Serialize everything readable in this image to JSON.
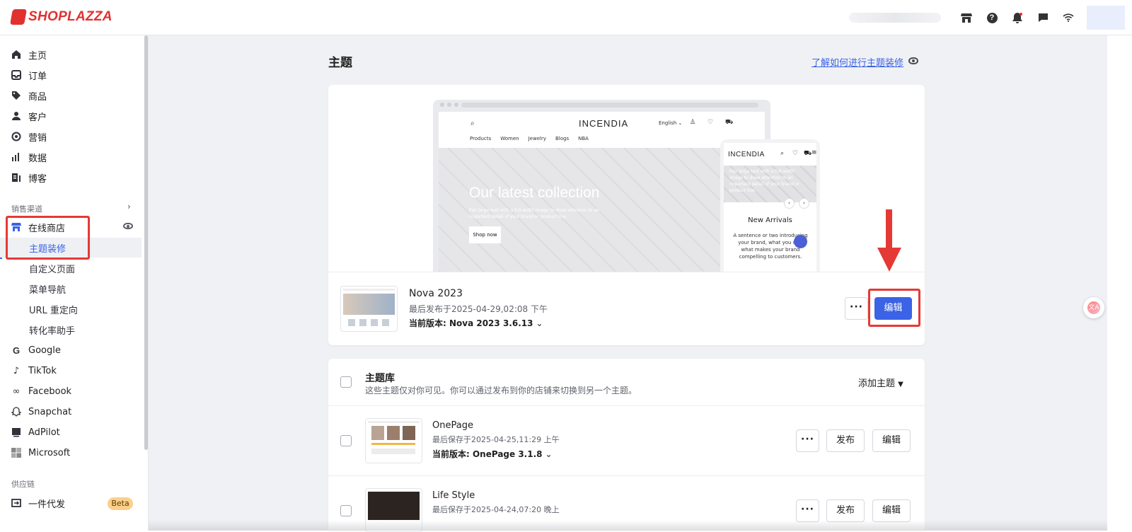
{
  "brand": {
    "name": "SHOPLAZZA",
    "color": "#e1312f"
  },
  "topbar": {
    "icons": [
      "store-icon",
      "help-icon",
      "bell-icon",
      "chat-icon",
      "wifi-icon"
    ],
    "help_glyph": "?"
  },
  "sidebar": {
    "main_items": [
      {
        "label": "主页",
        "icon": "home-icon"
      },
      {
        "label": "订单",
        "icon": "inbox-icon"
      },
      {
        "label": "商品",
        "icon": "tag-icon"
      },
      {
        "label": "客户",
        "icon": "person-icon"
      },
      {
        "label": "营销",
        "icon": "marketing-icon"
      },
      {
        "label": "数据",
        "icon": "bar-chart-icon"
      },
      {
        "label": "博客",
        "icon": "blog-icon"
      }
    ],
    "sales_channels_title": "销售渠道",
    "online_store_label": "在线商店",
    "online_store_sub": [
      "主题装修",
      "自定义页面",
      "菜单导航",
      "URL 重定向",
      "转化率助手"
    ],
    "channels": [
      {
        "label": "Google",
        "icon": "google-icon"
      },
      {
        "label": "TikTok",
        "icon": "tiktok-icon"
      },
      {
        "label": "Facebook",
        "icon": "meta-icon"
      },
      {
        "label": "Snapchat",
        "icon": "snapchat-icon"
      },
      {
        "label": "AdPilot",
        "icon": "adpilot-icon"
      },
      {
        "label": "Microsoft",
        "icon": "microsoft-icon"
      }
    ],
    "supply_title": "供应链",
    "dropship_label": "一件代发",
    "beta_label": "Beta"
  },
  "page": {
    "title": "主题",
    "learn_link": "了解如何进行主题装修"
  },
  "preview": {
    "brand": "INCENDIA",
    "lang": "English",
    "nav": [
      "Products",
      "Women",
      "Jewelry",
      "Blogs",
      "NBA"
    ],
    "hero_title": "Our latest collection",
    "hero_sub": "Pair large text with a full-width image to draw attention to an important detail of your brand or product line.",
    "shop_now": "Shop now",
    "mobile_brand": "INCENDIA",
    "mobile_hero_text": "Pair large text with a full-width image to draw attention to an important detail of your brand or product line.",
    "mobile_new": "New Arrivals",
    "mobile_desc": "A sentence or two introducing your brand, what you sell, what makes your brand compelling to customers."
  },
  "current_theme": {
    "name": "Nova 2023",
    "published": "最后发布于2025-04-29,02:08 下午",
    "version": "当前版本: Nova 2023 3.6.13",
    "more": "···",
    "edit": "编辑"
  },
  "library": {
    "title": "主题库",
    "desc": "这些主题仅对你可见。你可以通过发布到你的店铺来切换到另一个主题。",
    "add_theme": "添加主题",
    "themes": [
      {
        "name": "OnePage",
        "saved": "最后保存于2025-04-25,11:29 上午",
        "version": "当前版本: OnePage 3.1.8",
        "more": "···",
        "publish": "发布",
        "edit": "编辑"
      },
      {
        "name": "Life Style",
        "saved": "最后保存于2025-04-24,07:20 晚上",
        "more": "···",
        "publish": "发布",
        "edit": "编辑"
      }
    ]
  },
  "colors": {
    "accent": "#3a63e6",
    "annotation": "#e53935"
  }
}
